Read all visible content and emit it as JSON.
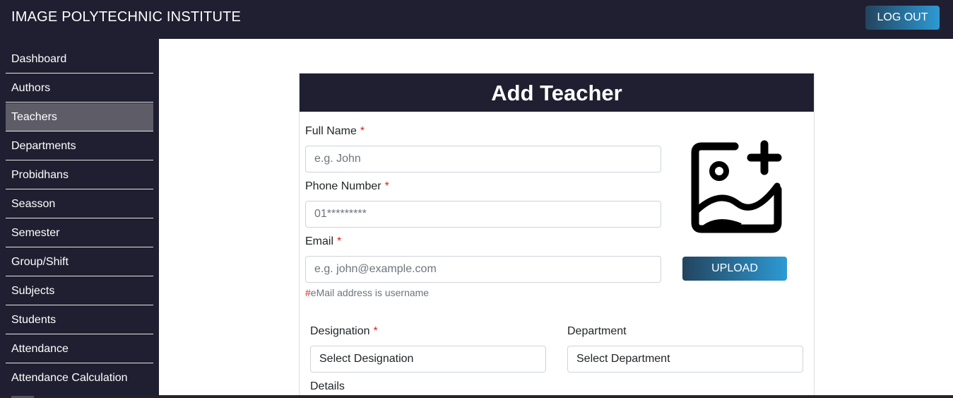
{
  "header": {
    "brand": "IMAGE POLYTECHNIC INSTITUTE",
    "logout_label": "LOG OUT"
  },
  "sidebar": {
    "items": [
      {
        "label": "Dashboard"
      },
      {
        "label": "Authors"
      },
      {
        "label": "Teachers",
        "active": true
      },
      {
        "label": "Departments"
      },
      {
        "label": "Probidhans"
      },
      {
        "label": "Seasson"
      },
      {
        "label": "Semester"
      },
      {
        "label": "Group/Shift"
      },
      {
        "label": "Subjects"
      },
      {
        "label": "Students"
      },
      {
        "label": "Attendance"
      },
      {
        "label": "Attendance Calculation"
      }
    ]
  },
  "form": {
    "title": "Add Teacher",
    "required_mark": "*",
    "full_name": {
      "label": "Full Name",
      "placeholder": "e.g. John"
    },
    "phone": {
      "label": "Phone Number",
      "placeholder": "01*********"
    },
    "email": {
      "label": "Email",
      "placeholder": "e.g. john@example.com"
    },
    "email_hint_mark": "#",
    "email_hint": "eMail address is username",
    "upload_label": "UPLOAD",
    "photo_icon": "add-photo-icon",
    "designation": {
      "label": "Designation",
      "value": "Select Designation"
    },
    "department": {
      "label": "Department",
      "value": "Select Department"
    },
    "details_label": "Details"
  },
  "colors": {
    "navbar_bg": "#1f1f31",
    "sidebar_active_bg": "#5d5c67",
    "button_gradient_start": "#23445e",
    "button_gradient_end": "#2d9ad4",
    "required_red": "#e02020"
  }
}
